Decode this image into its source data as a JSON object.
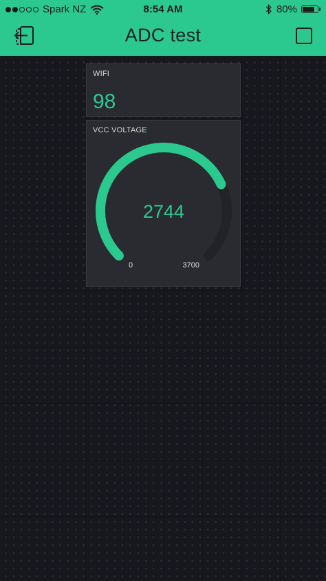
{
  "status_bar": {
    "carrier": "Spark NZ",
    "time": "8:54 AM",
    "battery": "80%",
    "battery_level": 0.8,
    "signal_bars": 2,
    "signal_total": 5
  },
  "header": {
    "title": "ADC test",
    "background_color": "#2bc98f"
  },
  "widgets": {
    "wifi": {
      "label": "WIFI",
      "value": "98"
    },
    "vcc": {
      "label": "VCC VOLTAGE",
      "value": 2744,
      "min": 0,
      "max": 3700,
      "min_label": "0",
      "max_label": "3700",
      "accent_color": "#2bc98f",
      "track_color": "#222326"
    }
  },
  "icons": {
    "back": "exit-app-icon",
    "stop": "stop-square-icon",
    "wifi": "wifi-signal-icon",
    "bluetooth": "bluetooth-icon",
    "battery": "battery-icon"
  }
}
